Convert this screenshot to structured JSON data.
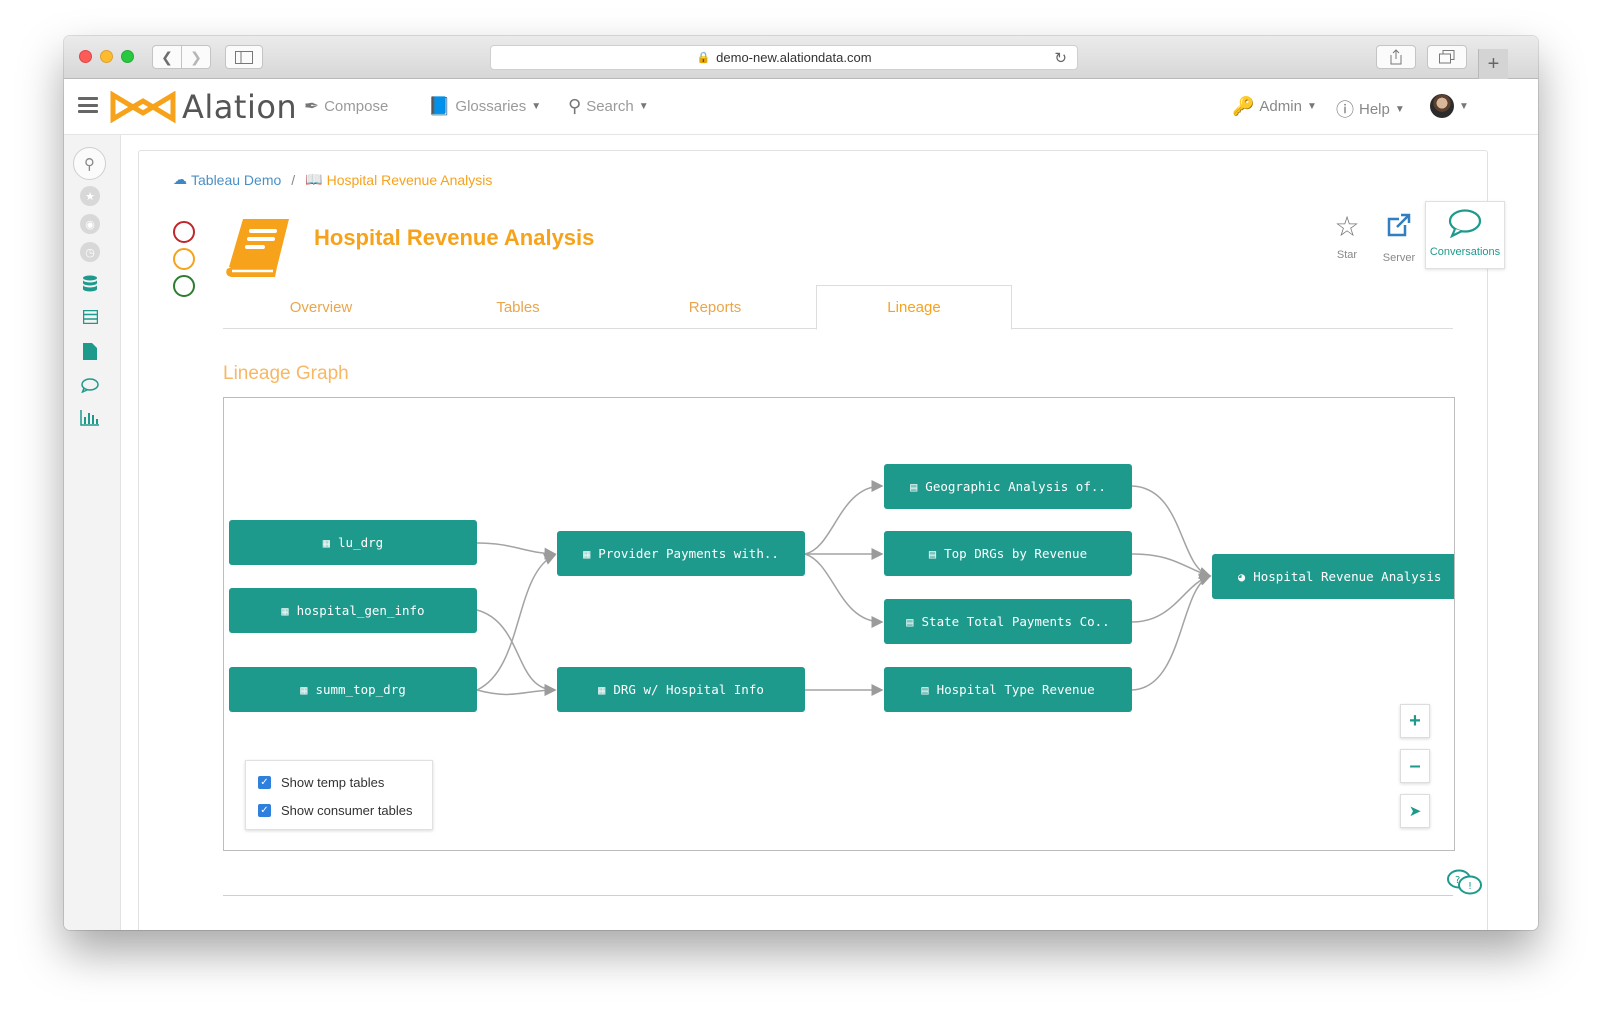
{
  "browser": {
    "url": "demo-new.alationdata.com"
  },
  "header": {
    "brand": "Alation",
    "nav": {
      "compose": "Compose",
      "glossaries": "Glossaries",
      "search": "Search",
      "admin": "Admin",
      "help": "Help"
    }
  },
  "breadcrumb": {
    "parent": "Tableau Demo",
    "separator": "/",
    "current": "Hospital Revenue Analysis"
  },
  "page": {
    "title": "Hospital Revenue Analysis"
  },
  "actions": {
    "star": "Star",
    "server": "Server",
    "conversations": "Conversations"
  },
  "tabs": {
    "overview": "Overview",
    "tables": "Tables",
    "reports": "Reports",
    "lineage": "Lineage"
  },
  "lineage": {
    "section_title": "Lineage Graph",
    "nodes": {
      "lu_drg": "lu_drg",
      "hospital_gen_info": "hospital_gen_info",
      "summ_top_drg": "summ_top_drg",
      "provider_payments": "Provider Payments with..",
      "drg_hospital_info": "DRG w/ Hospital Info",
      "geographic_analysis": "Geographic Analysis of..",
      "top_drgs": "Top DRGs by Revenue",
      "state_total_payments": "State Total Payments Co..",
      "hospital_type_revenue": "Hospital Type Revenue",
      "hospital_revenue_analysis": "Hospital Revenue Analysis"
    },
    "options": {
      "show_temp_tables": "Show temp tables",
      "show_consumer_tables": "Show consumer tables"
    }
  },
  "colors": {
    "accent_orange": "#f7a21b",
    "node_teal": "#1e9a8d",
    "link_blue": "#4a90c6"
  }
}
